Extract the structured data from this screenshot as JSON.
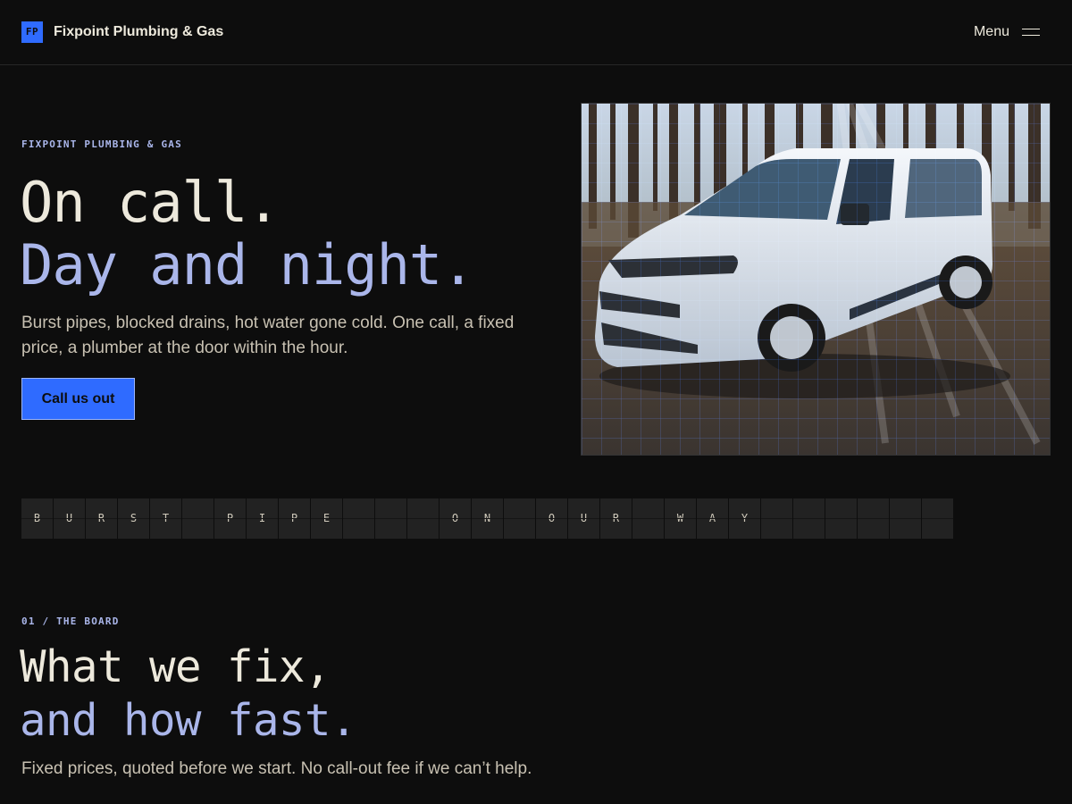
{
  "header": {
    "logo_initials": "FP",
    "brand_name": "Fixpoint Plumbing & Gas",
    "menu_label": "Menu"
  },
  "hero": {
    "eyebrow": "FIXPOINT PLUMBING & GAS",
    "title_line1": "On call.",
    "title_line2": "Day and night.",
    "subtitle": "Burst pipes, blocked drains, hot water gone cold. One call, a fixed price, a plumber at the door within the hour.",
    "cta_label": "Call us out",
    "photo_icon": "white-van-photo"
  },
  "flap_board": {
    "cells": [
      "B",
      "U",
      "R",
      "S",
      "T",
      " ",
      "P",
      "I",
      "P",
      "E",
      " ",
      "–",
      " ",
      "O",
      "N",
      " ",
      "O",
      "U",
      "R",
      " ",
      "W",
      "A",
      "Y",
      " ",
      " ",
      " ",
      " ",
      " ",
      " "
    ]
  },
  "section_board": {
    "eyebrow": "01 / THE BOARD",
    "title_line1": "What we fix,",
    "title_line2": "and how fast.",
    "subtitle": "Fixed prices, quoted before we start. No call-out fee if we can’t help."
  },
  "colors": {
    "background": "#0d0d0d",
    "accent_blue": "#2f6bff",
    "cream": "#ede9dc",
    "lavender": "#aab6ea",
    "flap_cell": "#222222"
  }
}
